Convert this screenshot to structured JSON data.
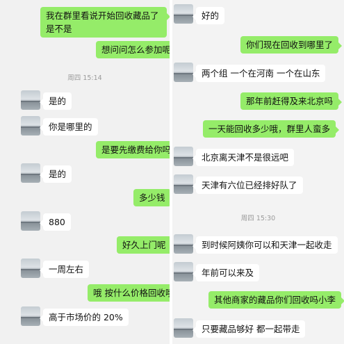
{
  "left": {
    "messages": [
      {
        "side": "right",
        "text": "我在群里看说开始回收藏品了是不是"
      },
      {
        "side": "right",
        "text": "想问问怎么参加呢"
      },
      {
        "side": "left",
        "text": "是的"
      },
      {
        "side": "left",
        "text": "你是哪里的"
      },
      {
        "side": "right",
        "text": "是要先缴费给你吗"
      },
      {
        "side": "left",
        "text": "是的"
      },
      {
        "side": "right",
        "text": "多少钱"
      },
      {
        "side": "left",
        "text": "880"
      },
      {
        "side": "right",
        "text": "好久上门呢"
      },
      {
        "side": "left",
        "text": "一周左右"
      },
      {
        "side": "right",
        "text": "哦 按什么价格回收哦"
      },
      {
        "side": "left",
        "text": "高于市场价的 20%"
      }
    ],
    "timestamp": "周四 15:14"
  },
  "right": {
    "messages": [
      {
        "side": "left",
        "text": "好的"
      },
      {
        "side": "right",
        "text": "你们现在回收到哪里了"
      },
      {
        "side": "left",
        "text": "两个组 一个在河南 一个在山东"
      },
      {
        "side": "right",
        "text": "那年前赶得及来北京吗"
      },
      {
        "side": "right",
        "text": "一天能回收多少哦，群里人蛮多"
      },
      {
        "side": "left",
        "text": "北京离天津不是很远吧"
      },
      {
        "side": "left",
        "text": "天津有六位已经排好队了"
      },
      {
        "side": "left",
        "text": "到时候阿姨你可以和天津一起收走"
      },
      {
        "side": "left",
        "text": "年前可以来及"
      },
      {
        "side": "right",
        "text": "其他商家的藏品你们回收吗小李"
      },
      {
        "side": "left",
        "text": "只要藏品够好 都一起带走"
      }
    ],
    "timestamp": "周四 15:30"
  },
  "colors": {
    "sent_bubble": "#95ec69",
    "received_bubble": "#ffffff",
    "background": "#f1f1f1"
  }
}
